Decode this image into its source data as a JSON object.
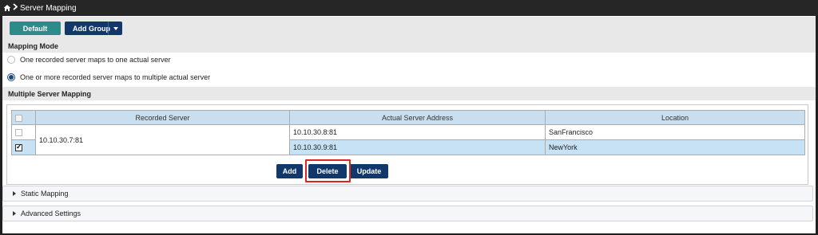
{
  "header": {
    "title": "Server Mapping",
    "home_icon": "home-icon",
    "separator_icon": "chevron-right-icon"
  },
  "toolbar": {
    "default_label": "Default",
    "add_group_label": "Add Group"
  },
  "mapping_mode": {
    "heading": "Mapping Mode",
    "options": [
      {
        "label": "One recorded server maps to one actual server",
        "selected": false
      },
      {
        "label": "One or more recorded server maps to multiple actual server",
        "selected": true
      }
    ]
  },
  "multiple": {
    "heading": "Multiple Server Mapping",
    "columns": [
      "Recorded Server",
      "Actual Server Address",
      "Location"
    ],
    "recorded_server": "10.10.30.7:81",
    "rows": [
      {
        "checked": false,
        "actual": "10.10.30.8:81",
        "location": "SanFrancisco"
      },
      {
        "checked": true,
        "actual": "10.10.30.9:81",
        "location": "NewYork"
      }
    ],
    "buttons": {
      "add": "Add",
      "delete": "Delete",
      "update": "Update"
    }
  },
  "accordions": {
    "static_mapping": "Static Mapping",
    "advanced_settings": "Advanced Settings"
  },
  "colors": {
    "teal": "#2e8b89",
    "navy": "#12386b",
    "selected_row": "#c7e2f5",
    "header": "#c9dff0",
    "highlight": "#e02424"
  }
}
